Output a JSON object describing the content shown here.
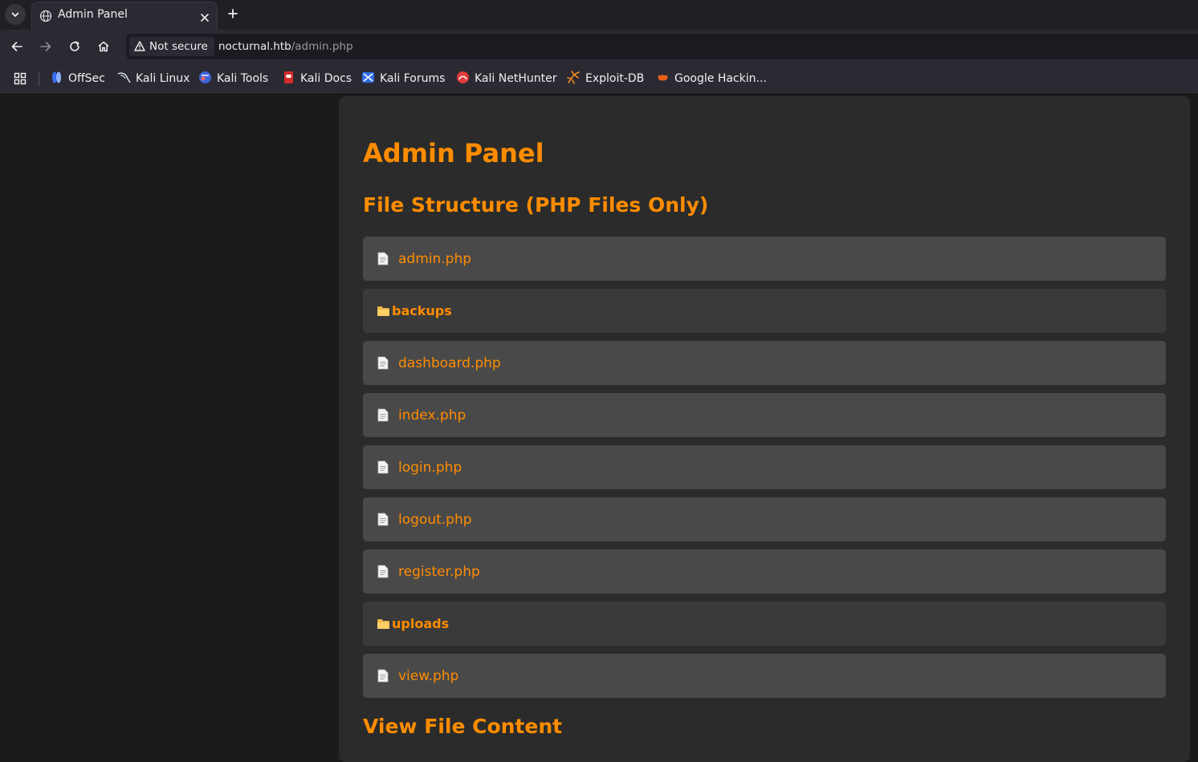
{
  "browser": {
    "tab": {
      "title": "Admin Panel"
    },
    "security_label": "Not secure",
    "url": {
      "host": "nocturnal.htb",
      "path": "/admin.php"
    },
    "bookmarks": [
      {
        "label": "OffSec",
        "icon": "offsec-icon"
      },
      {
        "label": "Kali Linux",
        "icon": "kali-linux-icon"
      },
      {
        "label": "Kali Tools",
        "icon": "kali-tools-icon"
      },
      {
        "label": "Kali Docs",
        "icon": "kali-docs-icon"
      },
      {
        "label": "Kali Forums",
        "icon": "kali-forums-icon"
      },
      {
        "label": "Kali NetHunter",
        "icon": "kali-nethunter-icon"
      },
      {
        "label": "Exploit-DB",
        "icon": "exploit-db-icon"
      },
      {
        "label": "Google Hackin...",
        "icon": "ghdb-icon"
      }
    ]
  },
  "page": {
    "title": "Admin Panel",
    "file_structure_heading": "File Structure (PHP Files Only)",
    "entries": [
      {
        "type": "file",
        "name": "admin.php"
      },
      {
        "type": "folder",
        "name": "backups"
      },
      {
        "type": "file",
        "name": "dashboard.php"
      },
      {
        "type": "file",
        "name": "index.php"
      },
      {
        "type": "file",
        "name": "login.php"
      },
      {
        "type": "file",
        "name": "logout.php"
      },
      {
        "type": "file",
        "name": "register.php"
      },
      {
        "type": "folder",
        "name": "uploads"
      },
      {
        "type": "file",
        "name": "view.php"
      }
    ],
    "view_content_heading": "View File Content"
  },
  "colors": {
    "accent": "#ff8c00",
    "file_row": "#494949",
    "folder_row": "#3a3a3a",
    "panel": "#2b2b2b"
  }
}
